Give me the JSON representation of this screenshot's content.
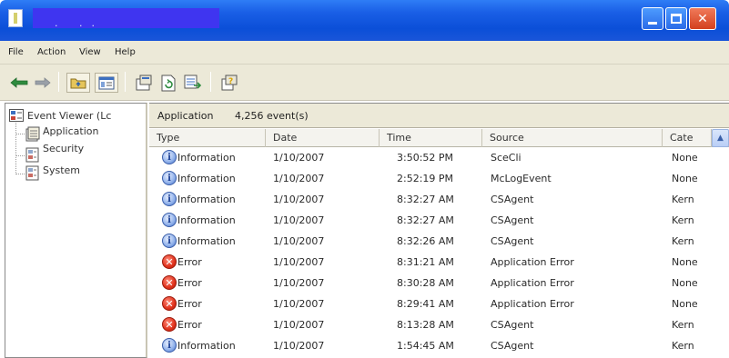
{
  "window": {
    "title": "",
    "title_suffix": ". ..",
    "colors": {
      "titlebar": "#0b4fd8",
      "title_highlight": "#3f35f0",
      "close": "#d3401e"
    }
  },
  "menu": [
    {
      "label": "File"
    },
    {
      "label": "Action"
    },
    {
      "label": "View"
    },
    {
      "label": "Help"
    }
  ],
  "toolbar": {
    "buttons": [
      {
        "icon": "back-arrow-icon"
      },
      {
        "icon": "forward-arrow-icon"
      },
      {
        "icon": "up-folder-icon"
      },
      {
        "icon": "show-hide-tree-icon"
      },
      {
        "icon": "properties-icon"
      },
      {
        "icon": "refresh-icon"
      },
      {
        "icon": "export-list-icon"
      },
      {
        "icon": "help-icon"
      }
    ]
  },
  "tree": {
    "root": "Event Viewer (Lc",
    "items": [
      {
        "label": "Application",
        "selected": true
      },
      {
        "label": "Security"
      },
      {
        "label": "System"
      }
    ]
  },
  "right": {
    "title": "Application",
    "count": "4,256 event(s)",
    "columns": [
      "Type",
      "Date",
      "Time",
      "Source",
      "Cate"
    ],
    "rows": [
      {
        "type": "Information",
        "icon": "information-icon",
        "date": "1/10/2007",
        "time": "3:50:52 PM",
        "source": "SceCli",
        "category": "None"
      },
      {
        "type": "Information",
        "icon": "information-icon",
        "date": "1/10/2007",
        "time": "2:52:19 PM",
        "source": "McLogEvent",
        "category": "None"
      },
      {
        "type": "Information",
        "icon": "information-icon",
        "date": "1/10/2007",
        "time": "8:32:27 AM",
        "source": "CSAgent",
        "category": "Kern"
      },
      {
        "type": "Information",
        "icon": "information-icon",
        "date": "1/10/2007",
        "time": "8:32:27 AM",
        "source": "CSAgent",
        "category": "Kern"
      },
      {
        "type": "Information",
        "icon": "information-icon",
        "date": "1/10/2007",
        "time": "8:32:26 AM",
        "source": "CSAgent",
        "category": "Kern"
      },
      {
        "type": "Error",
        "icon": "error-icon",
        "date": "1/10/2007",
        "time": "8:31:21 AM",
        "source": "Application Error",
        "category": "None"
      },
      {
        "type": "Error",
        "icon": "error-icon",
        "date": "1/10/2007",
        "time": "8:30:28 AM",
        "source": "Application Error",
        "category": "None"
      },
      {
        "type": "Error",
        "icon": "error-icon",
        "date": "1/10/2007",
        "time": "8:29:41 AM",
        "source": "Application Error",
        "category": "None"
      },
      {
        "type": "Error",
        "icon": "error-icon",
        "date": "1/10/2007",
        "time": "8:13:28 AM",
        "source": "CSAgent",
        "category": "Kern"
      },
      {
        "type": "Information",
        "icon": "information-icon",
        "date": "1/10/2007",
        "time": "1:54:45 AM",
        "source": "CSAgent",
        "category": "Kern"
      }
    ]
  }
}
